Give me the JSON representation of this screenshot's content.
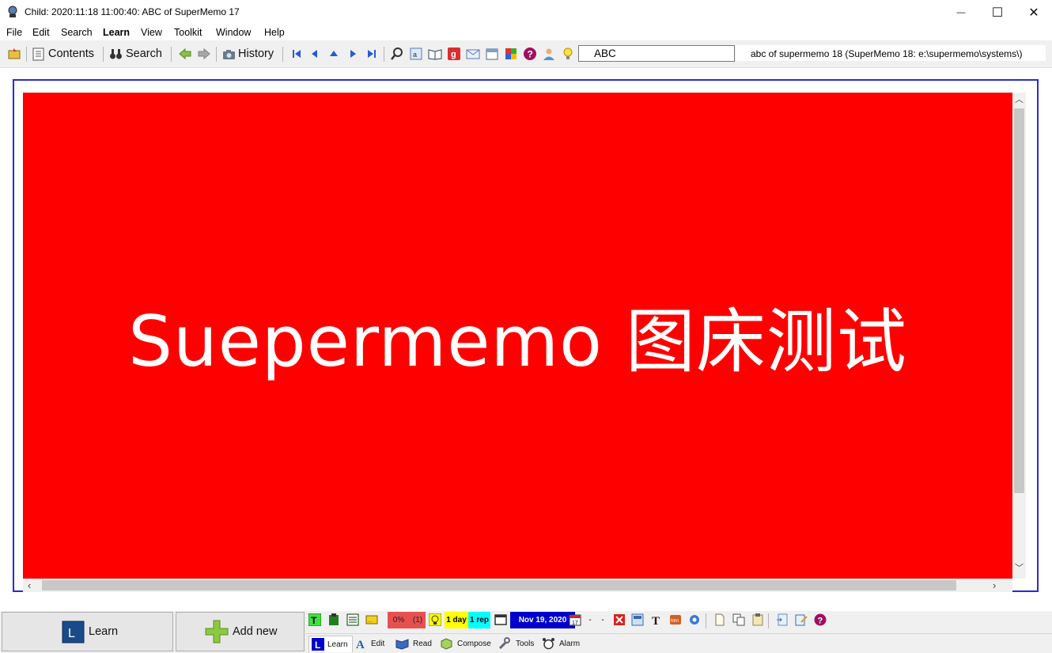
{
  "window": {
    "title": "Child: 2020:11:18 11:00:40: ABC of SuperMemo 17",
    "minimize_glyph": "—",
    "maximize_glyph": "☐",
    "close_glyph": "✕"
  },
  "menu": [
    "File",
    "Edit",
    "Search",
    "Learn",
    "View",
    "Toolkit",
    "Window",
    "Help"
  ],
  "toolbar": {
    "contents_label": "Contents",
    "search_label": "Search",
    "history_label": "History",
    "concept_value": "ABC",
    "collection_info": "abc of supermemo 18 (SuperMemo 18: e:\\supermemo\\systems\\)"
  },
  "content": {
    "text": "Suepermemo 图床测试",
    "background_color": "#ff0000",
    "text_color": "#ffffff"
  },
  "bottom": {
    "learn_label": "Learn",
    "add_new_label": "Add new",
    "status": {
      "percent": "0%",
      "count": "(1)",
      "interval": "1 day",
      "reps": "1 rep",
      "date": "Nov 19, 2020",
      "dash1": "-",
      "dash2": "-"
    },
    "tabs": [
      "Learn",
      "Edit",
      "Read",
      "Compose",
      "Tools",
      "Alarm"
    ]
  },
  "colors": {
    "accent_blue": "#2a2ad0",
    "status_red": "#e85050",
    "status_yellow": "#ffff00",
    "status_cyan": "#00ffff",
    "status_navy": "#0000cc"
  }
}
